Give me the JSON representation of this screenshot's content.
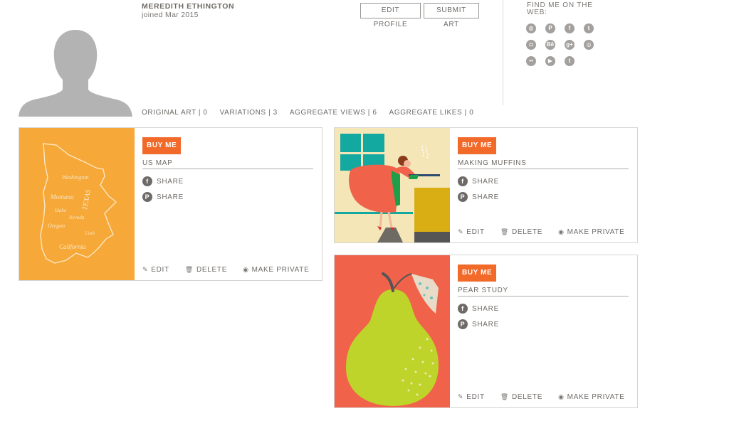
{
  "profile": {
    "name": "MEREDITH ETHINGTON",
    "joined": "joined Mar 2015"
  },
  "toolbar": {
    "edit_profile_label": "EDIT PROFILE",
    "submit_art_label": "SUBMIT ART"
  },
  "social": {
    "title": "FIND ME ON THE WEB:",
    "icons": [
      {
        "name": "website",
        "glyph": "◍"
      },
      {
        "name": "pinterest",
        "glyph": "P"
      },
      {
        "name": "facebook",
        "glyph": "f"
      },
      {
        "name": "twitter",
        "glyph": "t"
      },
      {
        "name": "instagram",
        "glyph": "◘"
      },
      {
        "name": "behance",
        "glyph": "Bē"
      },
      {
        "name": "google-plus",
        "glyph": "g+"
      },
      {
        "name": "dribbble",
        "glyph": "◎"
      },
      {
        "name": "flickr",
        "glyph": "••"
      },
      {
        "name": "youtube",
        "glyph": "▶"
      },
      {
        "name": "tumblr",
        "glyph": "t"
      }
    ]
  },
  "stats": [
    {
      "label": "ORIGINAL ART",
      "value": "0",
      "text": "ORIGINAL ART | 0"
    },
    {
      "label": "VARIATIONS",
      "value": "3",
      "text": "VARIATIONS | 3"
    },
    {
      "label": "AGGREGATE VIEWS",
      "value": "6",
      "text": "AGGREGATE VIEWS | 6"
    },
    {
      "label": "AGGREGATE LIKES",
      "value": "0",
      "text": "AGGREGATE LIKES | 0"
    }
  ],
  "artworks": [
    {
      "title": "US MAP",
      "buy_label": "BUY ME",
      "share_facebook": "SHARE",
      "share_pinterest": "SHARE",
      "edit_label": "EDIT",
      "delete_label": "DELETE",
      "privacy_label": "MAKE PRIVATE",
      "colors": {
        "background": "#f6a432"
      }
    },
    {
      "title": "MAKING MUFFINS",
      "buy_label": "BUY ME",
      "share_facebook": "SHARE",
      "share_pinterest": "SHARE",
      "edit_label": "EDIT",
      "delete_label": "DELETE",
      "privacy_label": "MAKE PRIVATE",
      "colors": {
        "background": "#f5e6b8"
      }
    },
    {
      "title": "PEAR STUDY",
      "buy_label": "BUY ME",
      "share_facebook": "SHARE",
      "share_pinterest": "SHARE",
      "edit_label": "EDIT",
      "delete_label": "DELETE",
      "privacy_label": "MAKE PRIVATE",
      "colors": {
        "background": "#f0624a"
      }
    }
  ],
  "icons": {
    "facebook": "f",
    "pinterest": "P",
    "edit": "✎",
    "delete": "🗑",
    "eye": "◉"
  },
  "theme": {
    "accent": "#f26a2a",
    "text": "#6e6a67"
  }
}
